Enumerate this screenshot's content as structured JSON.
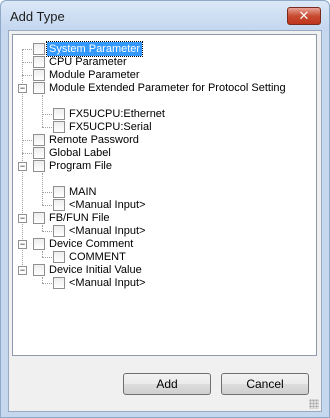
{
  "dialog": {
    "title": "Add Type",
    "close_glyph": "✕"
  },
  "tree": {
    "items": [
      {
        "label": "System Parameter",
        "selected": true
      },
      {
        "label": "CPU Parameter"
      },
      {
        "label": "Module Parameter"
      },
      {
        "label": "Module Extended Parameter for Protocol Setting",
        "expander": "−"
      },
      {
        "label": "FX5UCPU:Ethernet"
      },
      {
        "label": "FX5UCPU:Serial"
      },
      {
        "label": "Remote Password"
      },
      {
        "label": "Global Label"
      },
      {
        "label": "Program File",
        "expander": "−"
      },
      {
        "label": "MAIN"
      },
      {
        "label": "<Manual Input>"
      },
      {
        "label": "FB/FUN File",
        "expander": "−"
      },
      {
        "label": "<Manual Input>"
      },
      {
        "label": "Device Comment",
        "expander": "−"
      },
      {
        "label": "COMMENT"
      },
      {
        "label": "Device Initial Value",
        "expander": "−"
      },
      {
        "label": "<Manual Input>"
      }
    ]
  },
  "buttons": {
    "add": "Add",
    "cancel": "Cancel"
  }
}
